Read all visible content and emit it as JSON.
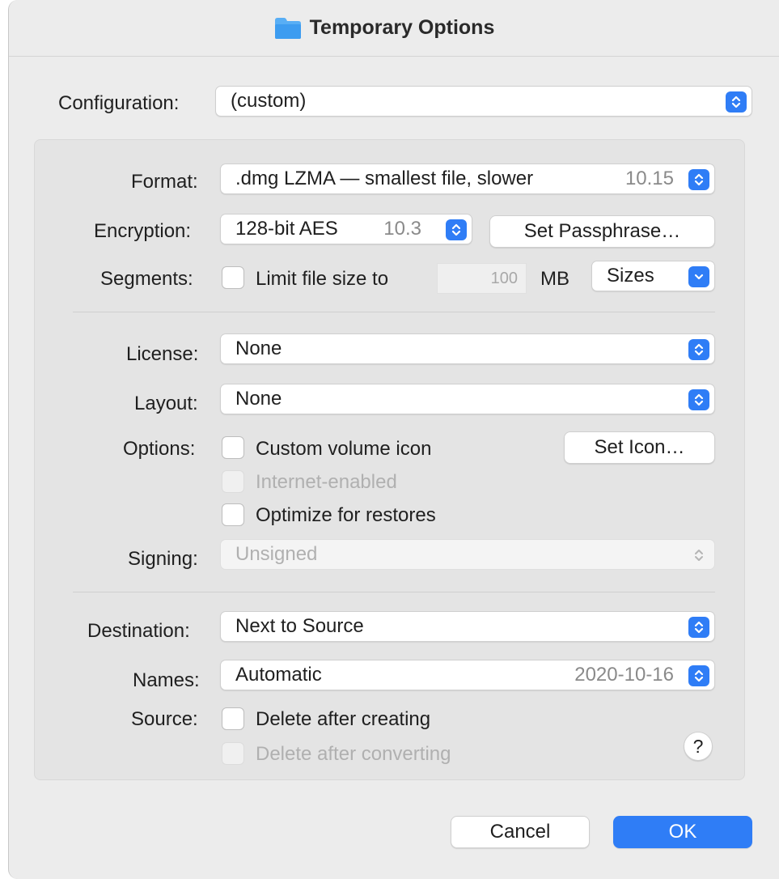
{
  "window": {
    "title": "Temporary Options"
  },
  "configuration": {
    "label": "Configuration:",
    "value": "(custom)"
  },
  "format": {
    "label": "Format:",
    "value": ".dmg LZMA — smallest file, slower",
    "version": "10.15"
  },
  "encryption": {
    "label": "Encryption:",
    "value": "128-bit AES",
    "version": "10.3",
    "button": "Set Passphrase…"
  },
  "segments": {
    "label": "Segments:",
    "checkbox_label": "Limit file size to",
    "checked": false,
    "size_value": "100",
    "unit": "MB",
    "sizes_button": "Sizes"
  },
  "license": {
    "label": "License:",
    "value": "None"
  },
  "layout": {
    "label": "Layout:",
    "value": "None"
  },
  "options": {
    "label": "Options:",
    "custom_icon": "Custom volume icon",
    "set_icon_button": "Set Icon…",
    "internet_enabled": "Internet-enabled",
    "optimize": "Optimize for restores"
  },
  "signing": {
    "label": "Signing:",
    "value": "Unsigned"
  },
  "destination": {
    "label": "Destination:",
    "value": "Next to Source"
  },
  "names": {
    "label": "Names:",
    "value": "Automatic",
    "date": "2020-10-16"
  },
  "source": {
    "label": "Source:",
    "delete_after_creating": "Delete after creating",
    "delete_after_converting": "Delete after converting"
  },
  "help": {
    "label": "?"
  },
  "footer": {
    "cancel": "Cancel",
    "ok": "OK"
  },
  "colors": {
    "accent": "#2f7df6",
    "panel": "#e4e4e4",
    "window": "#ececec"
  },
  "icons": {
    "title": "folder-icon",
    "popup": "up-down-chevron-icon",
    "pulldown": "chevron-down-icon"
  }
}
